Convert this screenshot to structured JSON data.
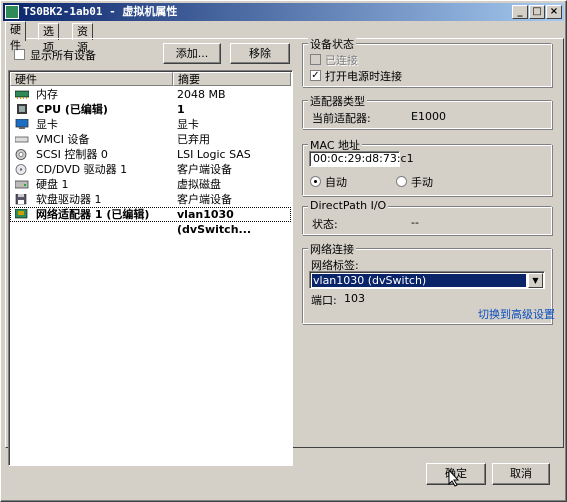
{
  "window": {
    "title": "TS0BK2-1ab01 - 虚拟机属性"
  },
  "tabs": [
    {
      "label": "硬件",
      "active": true
    },
    {
      "label": "选项",
      "active": false
    },
    {
      "label": "资源",
      "active": false
    }
  ],
  "hardware": {
    "show_all_label": "显示所有设备",
    "show_all_checked": false,
    "add_label": "添加...",
    "remove_label": "移除",
    "col_hardware": "硬件",
    "col_summary": "摘要",
    "rows": [
      {
        "name": "内存",
        "summary": "2048 MB",
        "icon": "memory-icon",
        "bold": false
      },
      {
        "name": "CPU (已编辑)",
        "summary": "1",
        "icon": "cpu-icon",
        "bold": true
      },
      {
        "name": "显卡",
        "summary": "显卡",
        "icon": "video-card-icon",
        "bold": false
      },
      {
        "name": "VMCI 设备",
        "summary": "已弃用",
        "icon": "vmci-icon",
        "bold": false
      },
      {
        "name": "SCSI 控制器 0",
        "summary": "LSI Logic SAS",
        "icon": "scsi-icon",
        "bold": false
      },
      {
        "name": "CD/DVD 驱动器 1",
        "summary": "客户端设备",
        "icon": "cd-dvd-icon",
        "bold": false
      },
      {
        "name": "硬盘 1",
        "summary": "虚拟磁盘",
        "icon": "hard-disk-icon",
        "bold": false
      },
      {
        "name": "软盘驱动器 1",
        "summary": "客户端设备",
        "icon": "floppy-icon",
        "bold": false
      },
      {
        "name": "网络适配器 1 (已编辑)",
        "summary": "vlan1030 (dvSwitch...",
        "icon": "network-adapter-icon",
        "bold": true,
        "selected": true
      }
    ]
  },
  "device_status": {
    "title": "设备状态",
    "connected_label": "已连接",
    "connected_checked": false,
    "power_on_label": "打开电源时连接",
    "power_on_checked": true
  },
  "adapter_type": {
    "title": "适配器类型",
    "current_label": "当前适配器:",
    "current_value": "E1000"
  },
  "mac": {
    "title": "MAC 地址",
    "value": "00:0c:29:d8:73:c1",
    "auto_label": "自动",
    "manual_label": "手动",
    "selected": "auto"
  },
  "directpath": {
    "title": "DirectPath I/O",
    "status_label": "状态:",
    "status_value": "--"
  },
  "network_connection": {
    "title": "网络连接",
    "label_label": "网络标签:",
    "label_value": "vlan1030 (dvSwitch)",
    "port_label": "端口:",
    "port_value": "103",
    "advanced_link": "切换到高级设置"
  },
  "footer": {
    "ok_label": "确定",
    "cancel_label": "取消"
  }
}
